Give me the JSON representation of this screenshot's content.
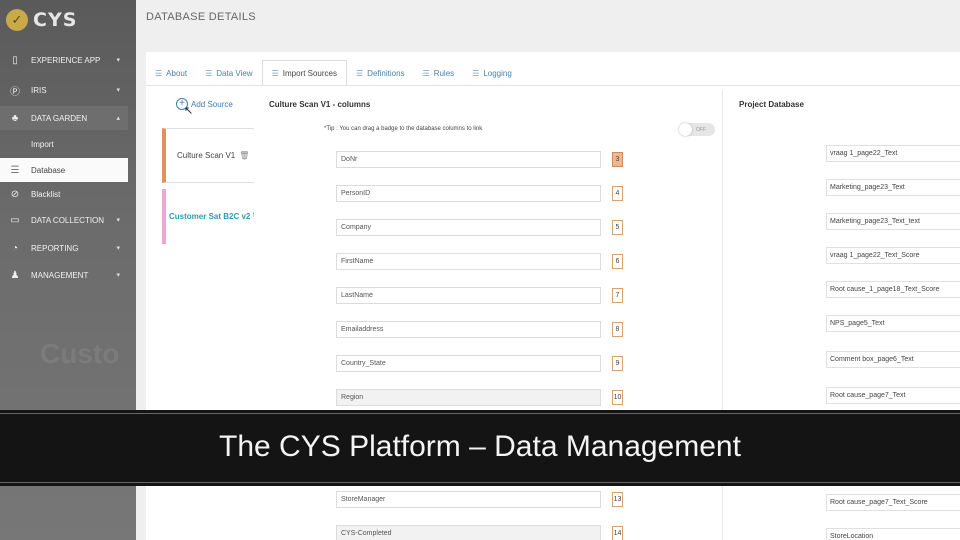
{
  "brand": {
    "name": "CYS",
    "accent": "#c9a94a"
  },
  "sidebar": {
    "items": [
      {
        "label": "EXPERIENCE APP",
        "icon": "phone-icon",
        "chevron": "▾"
      },
      {
        "label": "IRIS",
        "icon": "p-circle-icon",
        "chevron": "▾"
      },
      {
        "label": "DATA GARDEN",
        "icon": "tree-icon",
        "chevron": "▴"
      },
      {
        "label": "Import",
        "icon": ""
      },
      {
        "label": "Database",
        "icon": "database-icon"
      },
      {
        "label": "Blacklist",
        "icon": "ban-icon"
      },
      {
        "label": "DATA COLLECTION",
        "icon": "inbox-icon",
        "chevron": "▾"
      },
      {
        "label": "REPORTING",
        "icon": "pie-chart-icon",
        "chevron": "▾"
      },
      {
        "label": "MANAGEMENT",
        "icon": "users-icon",
        "chevron": "▾"
      }
    ],
    "watermark": "Custo"
  },
  "page": {
    "title": "DATABASE DETAILS"
  },
  "tabs": [
    {
      "label": "About",
      "icon": "list-icon"
    },
    {
      "label": "Data View",
      "icon": "list-icon"
    },
    {
      "label": "Import Sources",
      "icon": "list-icon"
    },
    {
      "label": "Definitions",
      "icon": "list-icon"
    },
    {
      "label": "Rules",
      "icon": "list-icon"
    },
    {
      "label": "Logging",
      "icon": "list-icon"
    }
  ],
  "sources": {
    "add_label": "Add Source",
    "items": [
      {
        "name": "Culture Scan V1",
        "color": "#e0915d"
      },
      {
        "name": "Customer Sat B2C v2",
        "color": "#f0a4d8"
      }
    ]
  },
  "columns": {
    "header": "Culture Scan V1 - columns",
    "tip": "*Tip : You can drag a badge to the database columns to link",
    "toggle_label": "OFF",
    "fields": [
      {
        "name": "DoNr",
        "badge": "3"
      },
      {
        "name": "PersonID",
        "badge": "4"
      },
      {
        "name": "Company",
        "badge": "5"
      },
      {
        "name": "FirstName",
        "badge": "6"
      },
      {
        "name": "LastName",
        "badge": "7"
      },
      {
        "name": "Emailaddress",
        "badge": "8"
      },
      {
        "name": "Country_State",
        "badge": "9"
      },
      {
        "name": "Region",
        "badge": "10"
      },
      {
        "name": "StoreManager",
        "badge": "13"
      },
      {
        "name": "CYS-Completed",
        "badge": "14"
      }
    ]
  },
  "project_db": {
    "header": "Project Database",
    "fields": [
      "vraag 1_page22_Text",
      "Marketing_page23_Text",
      "Marketing_page23_Text_text",
      "vraag 1_page22_Text_Score",
      "Root cause_1_page18_Text_Score",
      "NPS_page5_Text",
      "Comment box_page6_Text",
      "Root cause_page7_Text",
      "Root cause_page7_Text_Score",
      "StoreLocation"
    ]
  },
  "caption": "The CYS Platform – Data Management"
}
